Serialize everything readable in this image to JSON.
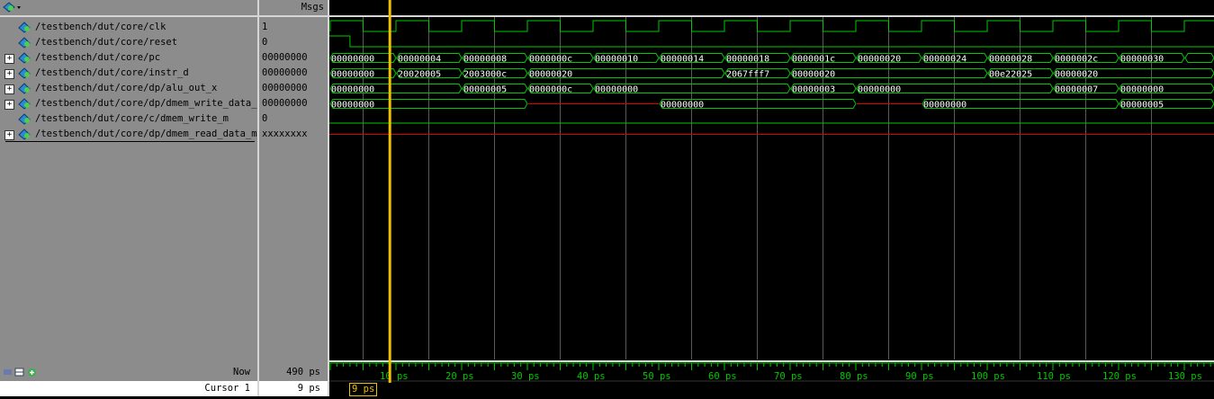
{
  "header": {
    "msgs_label": "Msgs"
  },
  "signals": [
    {
      "name": "/testbench/dut/core/clk",
      "value": "1",
      "expandable": false
    },
    {
      "name": "/testbench/dut/core/reset",
      "value": "0",
      "expandable": false
    },
    {
      "name": "/testbench/dut/core/pc",
      "value": "00000000",
      "expandable": true
    },
    {
      "name": "/testbench/dut/core/instr_d",
      "value": "00000000",
      "expandable": true
    },
    {
      "name": "/testbench/dut/core/dp/alu_out_x",
      "value": "00000000",
      "expandable": true
    },
    {
      "name": "/testbench/dut/core/dp/dmem_write_data_m",
      "value": "00000000",
      "expandable": true
    },
    {
      "name": "/testbench/dut/core/c/dmem_write_m",
      "value": "0",
      "expandable": false
    },
    {
      "name": "/testbench/dut/core/dp/dmem_read_data_m",
      "value": "xxxxxxxx",
      "expandable": true
    }
  ],
  "status": {
    "now_label": "Now",
    "now_value": "490 ps",
    "cursor_label": "Cursor 1",
    "cursor_value": "9 ps",
    "cursor_tag": "9 ps"
  },
  "timeline": {
    "ticks": [
      "10 ps",
      "20 ps",
      "30 ps",
      "40 ps",
      "50 ps",
      "60 ps",
      "70 ps",
      "80 ps",
      "90 ps",
      "100 ps",
      "110 ps",
      "120 ps",
      "130 ps"
    ],
    "cursor_time_ps": 9
  },
  "waves": {
    "pc": [
      {
        "t": 0,
        "v": "00000000"
      },
      {
        "t": 10,
        "v": "00000004"
      },
      {
        "t": 20,
        "v": "00000008"
      },
      {
        "t": 30,
        "v": "0000000c"
      },
      {
        "t": 40,
        "v": "00000010"
      },
      {
        "t": 50,
        "v": "00000014"
      },
      {
        "t": 60,
        "v": "00000018"
      },
      {
        "t": 70,
        "v": "0000001c"
      },
      {
        "t": 80,
        "v": "00000020"
      },
      {
        "t": 90,
        "v": "00000024"
      },
      {
        "t": 100,
        "v": "00000028"
      },
      {
        "t": 110,
        "v": "0000002c"
      },
      {
        "t": 120,
        "v": "00000030"
      },
      {
        "t": 130,
        "v": ""
      }
    ],
    "instr_d": [
      {
        "t": 0,
        "v": "00000000"
      },
      {
        "t": 10,
        "v": "20020005"
      },
      {
        "t": 20,
        "v": "2003000c"
      },
      {
        "t": 30,
        "v": "00000020"
      },
      {
        "t": 60,
        "v": "2067fff7"
      },
      {
        "t": 70,
        "v": "00000020"
      },
      {
        "t": 100,
        "v": "00e22025"
      },
      {
        "t": 110,
        "v": "00000020"
      }
    ],
    "alu_out_x": [
      {
        "t": 0,
        "v": "00000000"
      },
      {
        "t": 20,
        "v": "00000005"
      },
      {
        "t": 30,
        "v": "0000000c"
      },
      {
        "t": 40,
        "v": "00000000"
      },
      {
        "t": 70,
        "v": "00000003"
      },
      {
        "t": 80,
        "v": "00000000"
      },
      {
        "t": 110,
        "v": "00000007"
      },
      {
        "t": 120,
        "v": "00000000"
      }
    ],
    "dmem_write_data_m": [
      {
        "t": 0,
        "v": "00000000"
      },
      {
        "t": 30,
        "v": "",
        "x": true
      },
      {
        "t": 50,
        "v": "00000000"
      },
      {
        "t": 80,
        "v": "",
        "x": true
      },
      {
        "t": 90,
        "v": "00000000"
      },
      {
        "t": 120,
        "v": "00000005"
      }
    ]
  },
  "colors": {
    "wave_green": "#00c800",
    "x_red": "#e00000",
    "cursor_yellow": "#f0c000",
    "grid": "#5a5a5a"
  }
}
